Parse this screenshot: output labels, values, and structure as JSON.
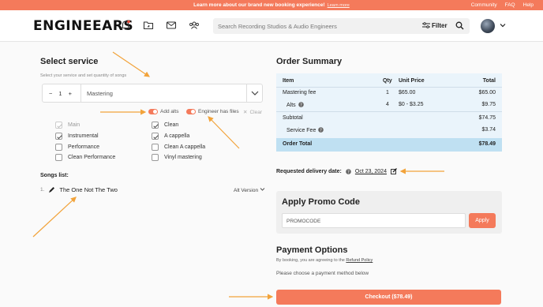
{
  "colors": {
    "accent": "#f47a5b",
    "summary_bg": "#eaf4fb",
    "summary_total_bg": "#bfe0f2",
    "annotation_arrow": "#f2a33a"
  },
  "announcement": {
    "text": "Learn more about our brand new booking experience!",
    "link": "Learn more",
    "links": [
      "Community",
      "FAQ",
      "Help"
    ]
  },
  "header": {
    "logo": "ENGINEEARS",
    "icons": [
      "bell-icon",
      "folder-icon",
      "mail-icon",
      "users-icon"
    ],
    "search_placeholder": "Search Recording Studios & Audio Engineers",
    "filter_label": "Filter"
  },
  "select_service": {
    "title": "Select service",
    "subtitle": "Select your service and set quantity of songs",
    "quantity": "1",
    "minus": "−",
    "plus": "+",
    "service": "Mastering",
    "toggle_add_alts": "Add alts",
    "toggle_engineer_files": "Engineer has files",
    "clear": "Clear",
    "options_left": [
      {
        "label": "Main",
        "checked": true,
        "disabled": true
      },
      {
        "label": "Instrumental",
        "checked": true,
        "disabled": false
      },
      {
        "label": "Performance",
        "checked": false,
        "disabled": false
      },
      {
        "label": "Clean Performance",
        "checked": false,
        "disabled": false
      }
    ],
    "options_right": [
      {
        "label": "Clean",
        "checked": true,
        "disabled": false
      },
      {
        "label": "A cappella",
        "checked": true,
        "disabled": false
      },
      {
        "label": "Clean A cappella",
        "checked": false,
        "disabled": false
      },
      {
        "label": "Vinyl mastering",
        "checked": false,
        "disabled": false
      }
    ],
    "songs_title": "Songs list:",
    "song_number": "1.",
    "song_name": "The One Not The Two",
    "alt_version": "Alt Version"
  },
  "order_summary": {
    "title": "Order Summary",
    "headers": {
      "item": "Item",
      "qty": "Qty",
      "unit_price": "Unit Price",
      "total": "Total"
    },
    "rows": [
      {
        "item": "Mastering fee",
        "qty": "1",
        "unit_price": "$65.00",
        "total": "$65.00"
      },
      {
        "item": "Alts",
        "qty": "4",
        "unit_price": "$0 - $3.25",
        "total": "$9.75"
      }
    ],
    "subtotal_label": "Subtotal",
    "subtotal": "$74.75",
    "service_fee_label": "Service Fee",
    "service_fee": "$3.74",
    "order_total_label": "Order Total",
    "order_total": "$78.49"
  },
  "delivery": {
    "label": "Requested delivery date:",
    "date": "Oct 23, 2024"
  },
  "promo": {
    "title": "Apply Promo Code",
    "placeholder": "PROMOCODE",
    "button": "Apply"
  },
  "payment": {
    "title": "Payment Options",
    "agree_prefix": "By booking, you are agreeing to the",
    "refund_policy": "Refund Policy",
    "choose_text": "Please choose a payment method below",
    "checkout_button": "Checkout ($78.49)"
  }
}
